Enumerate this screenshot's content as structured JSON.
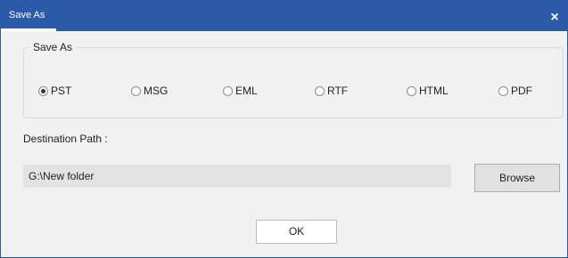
{
  "window": {
    "title": "Save As",
    "close_glyph": "×"
  },
  "save_as_group": {
    "legend": "Save As",
    "options": [
      {
        "label": "PST",
        "selected": true
      },
      {
        "label": "MSG",
        "selected": false
      },
      {
        "label": "EML",
        "selected": false
      },
      {
        "label": "RTF",
        "selected": false
      },
      {
        "label": "HTML",
        "selected": false
      },
      {
        "label": "PDF",
        "selected": false
      }
    ]
  },
  "destination": {
    "label": "Destination Path :",
    "value": "G:\\New folder",
    "browse_label": "Browse"
  },
  "ok_label": "OK",
  "colors": {
    "titlebar": "#2b5ba8",
    "dialog_bg": "#f1f1f1",
    "path_field_bg": "#e3e3e3"
  }
}
